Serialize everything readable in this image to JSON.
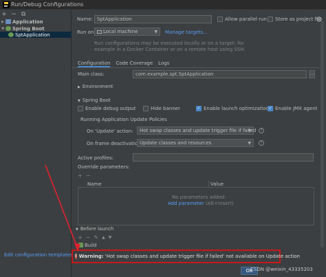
{
  "window": {
    "title": "Run/Debug Configurations"
  },
  "left_toolbar": {
    "add": "+",
    "remove": "−",
    "copy": "⧉"
  },
  "tree": {
    "application": "Application",
    "spring_boot": "Spring Boot",
    "spt_application": "SptApplication"
  },
  "edit_templates_link": "Edit configuration templates...",
  "form": {
    "name_label": "Name:",
    "name_value": "SptApplication",
    "allow_parallel_label": "Allow parallel run",
    "store_as_file_label": "Store as project file",
    "run_on_label": "Run on:",
    "run_on_value": "Local machine",
    "manage_targets": "Manage targets...",
    "run_on_hint_1": "Run configurations may be executed locally or on a target: for",
    "run_on_hint_2": "example in a Docker Container or on a remote host using SSH."
  },
  "tabs": [
    "Configuration",
    "Code Coverage",
    "Logs"
  ],
  "main_class": {
    "label": "Main class:",
    "value": "com.example.spt.SptApplication",
    "browse": "..."
  },
  "environment_section": "Environment",
  "spring_boot_section": "Spring Boot",
  "spring_options": {
    "debug_output": "Enable debug output",
    "hide_banner": "Hide banner",
    "launch_optimization": "Enable launch optimization",
    "jmx_agent": "Enable JMX agent"
  },
  "update_policies": {
    "title": "Running Application Update Policies",
    "update_action_label": "On 'Update' action:",
    "update_action_value": "Hot swap classes and update trigger file if failed",
    "frame_deactivation_label": "On frame deactivation:",
    "frame_deactivation_value": "Update classes and resources"
  },
  "active_profiles_label": "Active profiles:",
  "override_parameters": {
    "label": "Override parameters:",
    "col_name": "Name",
    "col_value": "Value",
    "empty_text": "No parameters added.",
    "add_link": "Add parameter",
    "add_shortcut": " (Alt+Insert)"
  },
  "table_toolbar": {
    "add": "+",
    "remove": "−"
  },
  "before_launch": {
    "label": "Before launch",
    "build": "Build"
  },
  "bl_toolbar": {
    "add": "+",
    "remove": "−",
    "edit": "✎",
    "up": "▲",
    "down": "▼"
  },
  "warning": {
    "prefix": "Warning:",
    "text": " 'Hot swap classes and update trigger file if failed' not available on Update action"
  },
  "buttons": {
    "ok": "OK"
  },
  "watermark": "CSDN @weixin_43335203",
  "colors": {
    "accent": "#4a88c7",
    "link": "#589df6",
    "warning_border": "#c81818",
    "annotation_arrow": "#e0212f"
  }
}
